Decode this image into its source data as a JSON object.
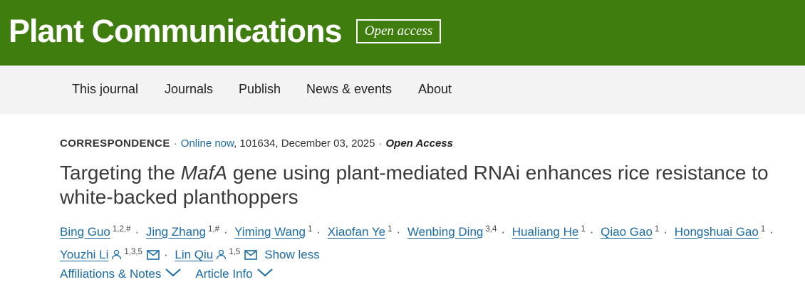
{
  "header": {
    "brand": "Plant Communications",
    "badge": "Open access",
    "brand_color": "#3f7d0e"
  },
  "nav": {
    "items": [
      {
        "label": "This journal"
      },
      {
        "label": "Journals"
      },
      {
        "label": "Publish"
      },
      {
        "label": "News & events"
      },
      {
        "label": "About"
      }
    ]
  },
  "article": {
    "type": "CORRESPONDENCE",
    "online_label": "Online now",
    "citation": ", 101634, December 03, 2025",
    "access": "Open Access",
    "title_prefix": "Targeting the ",
    "title_gene": "MafA",
    "title_suffix": " gene using plant-mediated RNAi enhances rice resistance to white-backed planthoppers"
  },
  "authors": [
    {
      "name": "Bing Guo",
      "sup": "1,2,#"
    },
    {
      "name": "Jing Zhang",
      "sup": "1,#"
    },
    {
      "name": "Yiming Wang",
      "sup": "1"
    },
    {
      "name": "Xiaofan Ye",
      "sup": "1"
    },
    {
      "name": "Wenbing Ding",
      "sup": "3,4"
    },
    {
      "name": "Hualiang He",
      "sup": "1"
    },
    {
      "name": "Qiao Gao",
      "sup": "1"
    },
    {
      "name": "Hongshuai Gao",
      "sup": "1"
    },
    {
      "name": "Youzhi Li",
      "sup": "1,3,5",
      "corresponding": true
    },
    {
      "name": "Lin Qiu",
      "sup": "1,5",
      "corresponding": true
    }
  ],
  "show_less": "Show less",
  "links": {
    "affiliations": "Affiliations & Notes",
    "article_info": "Article Info"
  },
  "icons": {
    "author_profile": "person-icon",
    "email": "envelope-icon",
    "dropdown": "chevron-down-icon"
  },
  "colors": {
    "link": "#1a6ba6",
    "nav_bg": "#f3f3f3"
  }
}
